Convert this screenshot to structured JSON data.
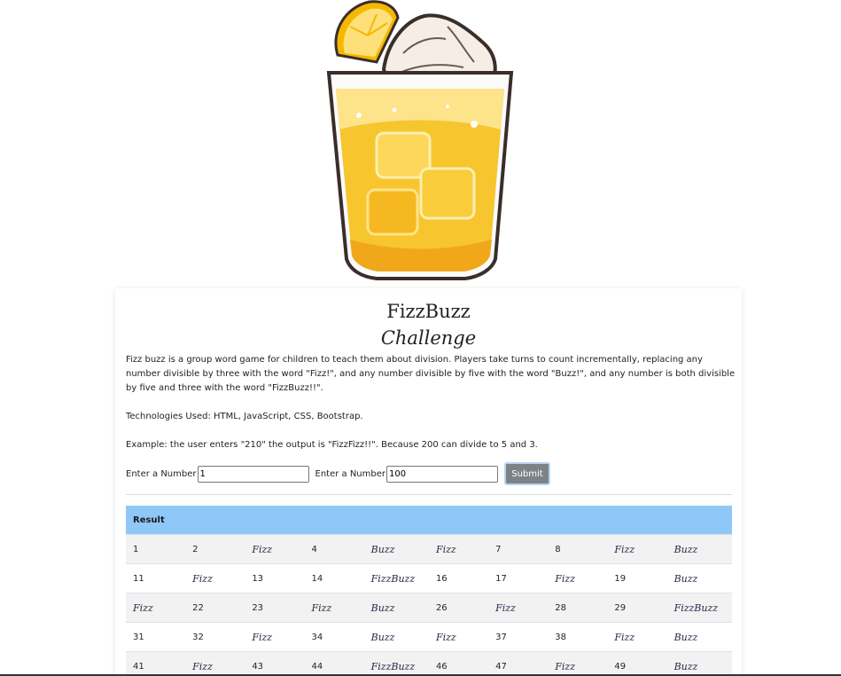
{
  "title_line1": "FizzBuzz",
  "title_line2": "Challenge",
  "description": "Fizz buzz is a group word game for children to teach them about division. Players take turns to count incrementally, replacing any number divisible by three with the word \"Fizz!\", and any number divisible by five with the word \"Buzz!\", and any number is both divisible by five and three with the word \"FizzBuzz!!\".",
  "technologies": "Technologies Used: HTML, JavaScript, CSS, Bootstrap.",
  "example": "Example: the user enters \"210\" the output is \"FizzFizz!!\". Because 200 can divide to 5 and 3.",
  "form": {
    "start_label": "Enter a Number",
    "start_value": "1",
    "end_label": "Enter a Number",
    "end_value": "100",
    "submit_label": "Submit"
  },
  "table": {
    "header": "Result",
    "rows": [
      [
        "1",
        "2",
        "Fizz",
        "4",
        "Buzz",
        "Fizz",
        "7",
        "8",
        "Fizz",
        "Buzz"
      ],
      [
        "11",
        "Fizz",
        "13",
        "14",
        "FizzBuzz",
        "16",
        "17",
        "Fizz",
        "19",
        "Buzz"
      ],
      [
        "Fizz",
        "22",
        "23",
        "Fizz",
        "Buzz",
        "26",
        "Fizz",
        "28",
        "29",
        "FizzBuzz"
      ],
      [
        "31",
        "32",
        "Fizz",
        "34",
        "Buzz",
        "Fizz",
        "37",
        "38",
        "Fizz",
        "Buzz"
      ],
      [
        "41",
        "Fizz",
        "43",
        "44",
        "FizzBuzz",
        "46",
        "47",
        "Fizz",
        "49",
        "Buzz"
      ]
    ]
  },
  "colors": {
    "table_header": "#8fc8f8",
    "submit_button": "#7d8287",
    "juice": "#f7c52e",
    "lemon": "#f5b800"
  },
  "hero_image": "lemonade-glass-illustration"
}
